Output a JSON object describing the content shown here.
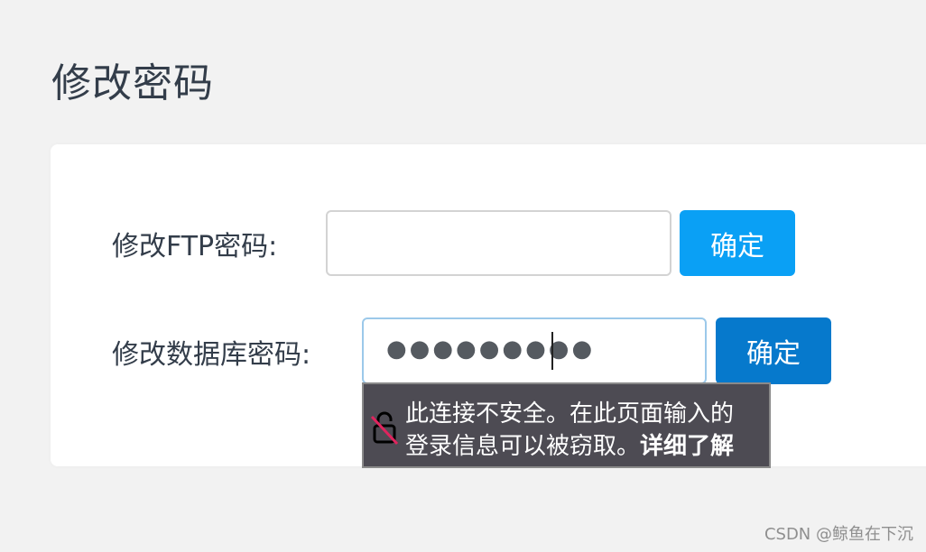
{
  "page": {
    "title": "修改密码"
  },
  "ftp": {
    "label": "修改FTP密码:",
    "value": "",
    "button": "确定"
  },
  "database": {
    "label": "修改数据库密码:",
    "masked_value": "●●●●●●●●●",
    "button": "确定"
  },
  "security_tooltip": {
    "icon": "insecure-lock-icon",
    "line1": "此连接不安全。在此页面输入的",
    "line2": "登录信息可以被窃取。",
    "link": "详细了解"
  },
  "watermark": "CSDN @鲸鱼在下沉",
  "colors": {
    "primary_button": "#0aa0f5",
    "primary_button_focused": "#0679cc",
    "tooltip_bg": "#4d4b53"
  }
}
